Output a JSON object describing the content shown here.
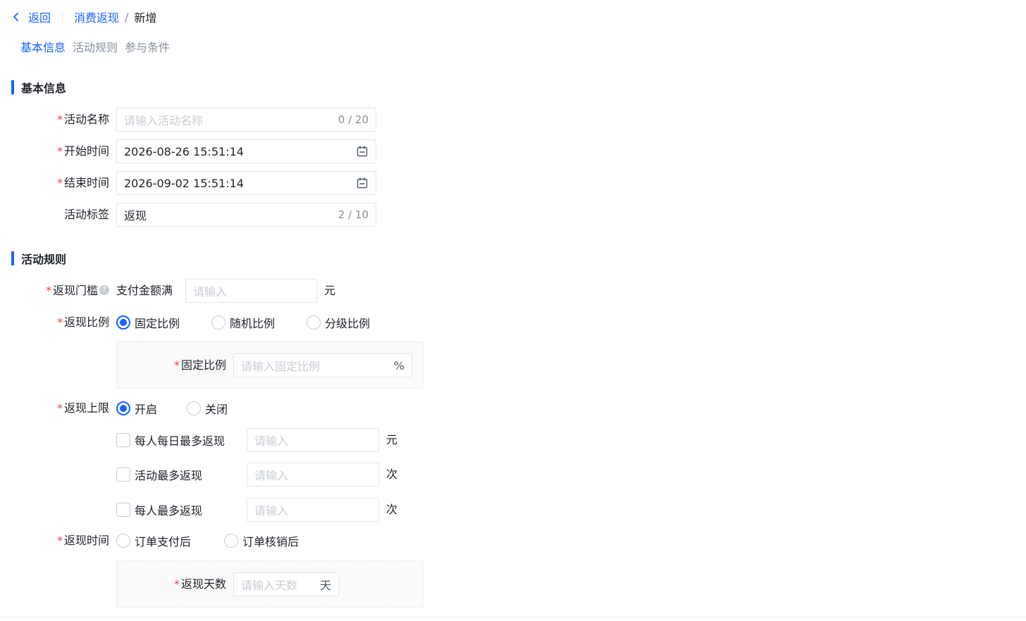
{
  "header": {
    "back_label": "返回",
    "breadcrumb_parent": "消费返现",
    "breadcrumb_sep": "/",
    "breadcrumb_current": "新增"
  },
  "anchors": {
    "basic": "基本信息",
    "rules": "活动规则",
    "conditions": "参与条件"
  },
  "basic": {
    "section_title": "基本信息",
    "name_label": "活动名称",
    "name_placeholder": "请输入活动名称",
    "name_count": "0 / 20",
    "start_label": "开始时间",
    "start_value": "2026-08-26 15:51:14",
    "end_label": "结束时间",
    "end_value": "2026-09-02 15:51:14",
    "tag_label": "活动标签",
    "tag_value": "返现",
    "tag_count": "2 / 10"
  },
  "rules": {
    "section_title": "活动规则",
    "threshold_label": "返现门槛",
    "threshold_help_icon": "question-icon",
    "threshold_prefix": "支付金额满",
    "threshold_placeholder": "请输入",
    "threshold_unit": "元",
    "ratio_label": "返现比例",
    "ratio_options": [
      "固定比例",
      "随机比例",
      "分级比例"
    ],
    "ratio_selected": "固定比例",
    "fixed_ratio_label": "固定比例",
    "fixed_ratio_placeholder": "请输入固定比例",
    "fixed_ratio_suffix": "%",
    "limit_label": "返现上限",
    "limit_options": [
      "开启",
      "关闭"
    ],
    "limit_selected": "开启",
    "limit_items": [
      {
        "label": "每人每日最多返现",
        "placeholder": "请输入",
        "unit": "元"
      },
      {
        "label": "活动最多返现",
        "placeholder": "请输入",
        "unit": "次"
      },
      {
        "label": "每人最多返现",
        "placeholder": "请输入",
        "unit": "次"
      }
    ],
    "time_label": "返现时间",
    "time_options": [
      "订单支付后",
      "订单核销后"
    ],
    "days_label": "返现天数",
    "days_placeholder": "请输入天数",
    "days_suffix": "天"
  },
  "colors": {
    "primary": "#1664ff",
    "required": "#f53f3f",
    "border": "#e5e6eb",
    "placeholder": "#c9cdd4"
  }
}
